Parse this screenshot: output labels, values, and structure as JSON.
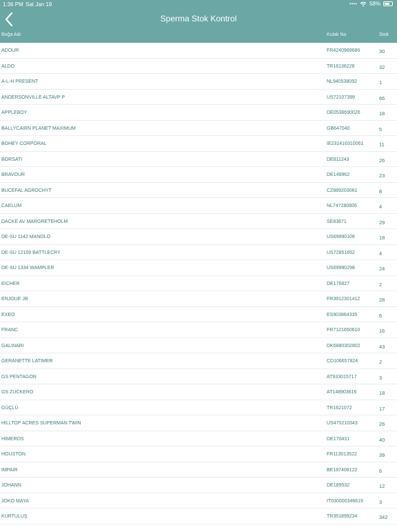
{
  "status_bar": {
    "time": "1:36 PM",
    "date": "Sat Jan 19",
    "battery": "58%",
    "dots": "••••"
  },
  "header": {
    "title": "Sperma Stok Kontrol"
  },
  "columns": {
    "name": "Boğa Adı",
    "ear_no": "Kulak No",
    "stock": "Stok"
  },
  "rows": [
    {
      "name": "ADOUR",
      "ear_no": "FR4240968686",
      "stock": "30"
    },
    {
      "name": "ALDO",
      "ear_no": "TR16136228",
      "stock": "32"
    },
    {
      "name": "A-L-H PRESENT",
      "ear_no": "NL940538092",
      "stock": "1"
    },
    {
      "name": "ANDERSONVILLE ALTAVP P",
      "ear_no": "US72107399",
      "stock": "66"
    },
    {
      "name": "APPLEBOY",
      "ear_no": "DE0538690026",
      "stock": "18"
    },
    {
      "name": "BALLYCAIRN PLANET MAXIMUM",
      "ear_no": "GB647040",
      "stock": "5"
    },
    {
      "name": "BOHEY CORPORAL",
      "ear_no": "IE231416310061",
      "stock": "11"
    },
    {
      "name": "BORSATI",
      "ear_no": "DE811243",
      "stock": "26"
    },
    {
      "name": "BRAVOUR",
      "ear_no": "DE149962",
      "stock": "23"
    },
    {
      "name": "BUCEFAL AGROCHYT",
      "ear_no": "CZ889203061",
      "stock": "8"
    },
    {
      "name": "CAELUM",
      "ear_no": "NL747280806",
      "stock": "4"
    },
    {
      "name": "DACKE AV MARGRETEHOLM",
      "ear_no": "SE83871",
      "stock": "29"
    },
    {
      "name": "DE-SU 1142 MANOLO",
      "ear_no": "US69990106",
      "stock": "18"
    },
    {
      "name": "DE-SU 12109 BATTLECRY",
      "ear_no": "US72851652",
      "stock": "4"
    },
    {
      "name": "DE-SU 1334 WAMPLER",
      "ear_no": "US69990298",
      "stock": "24"
    },
    {
      "name": "EICHER",
      "ear_no": "DE176827",
      "stock": "2"
    },
    {
      "name": "ENJOUE JB",
      "ear_no": "FR3912301412",
      "stock": "28"
    },
    {
      "name": "EXEO",
      "ear_no": "ES903864335",
      "stock": "6"
    },
    {
      "name": "FRANC",
      "ear_no": "FR7121650610",
      "stock": "16"
    },
    {
      "name": "GALINARI",
      "ear_no": "DK6880302802",
      "stock": "43"
    },
    {
      "name": "GERANETTE LATIMER",
      "ear_no": "CD106657824",
      "stock": "2"
    },
    {
      "name": "GS PENTAGON",
      "ear_no": "AT933015717",
      "stock": "3"
    },
    {
      "name": "GS ZUCKERO",
      "ear_no": "AT148903616",
      "stock": "18"
    },
    {
      "name": "GÜÇLÜ",
      "ear_no": "TR1621072",
      "stock": "17"
    },
    {
      "name": "HILLTOP ACRES SUPERMAN TWIN",
      "ear_no": "US470210343",
      "stock": "26"
    },
    {
      "name": "HIMEROS",
      "ear_no": "DE170431",
      "stock": "40"
    },
    {
      "name": "HOUSTON",
      "ear_no": "FR113013522",
      "stock": "39"
    },
    {
      "name": "IMPAIR",
      "ear_no": "BE187408122",
      "stock": "6"
    },
    {
      "name": "JOHANN",
      "ear_no": "DE189532",
      "stock": "12"
    },
    {
      "name": "JOKO MAYA",
      "ear_no": "IT030000346619",
      "stock": "3"
    },
    {
      "name": "KURTULUŞ",
      "ear_no": "TR351899234",
      "stock": "342"
    }
  ]
}
